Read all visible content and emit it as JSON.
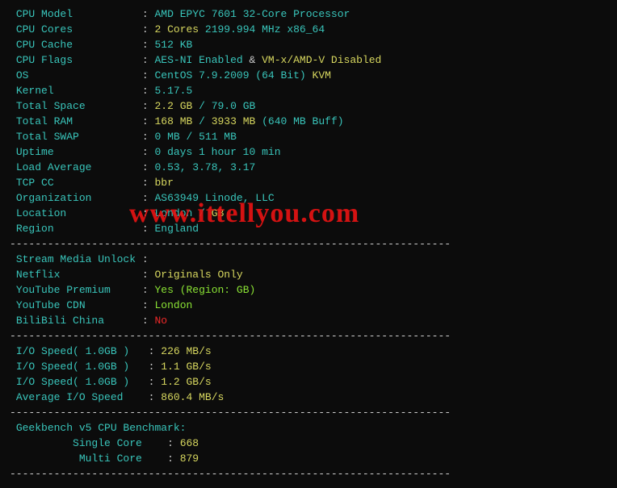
{
  "sys": {
    "cpu_model_label": "CPU Model",
    "cpu_model": "AMD EPYC 7601 32-Core Processor",
    "cpu_cores_label": "CPU Cores",
    "cpu_cores_count": "2 Cores",
    "cpu_cores_freq": "2199.994 MHz x86_64",
    "cpu_cache_label": "CPU Cache",
    "cpu_cache": "512 KB",
    "cpu_flags_label": "CPU Flags",
    "cpu_flags_a": "AES-NI Enabled",
    "amp": " & ",
    "cpu_flags_b": "VM-x/AMD-V Disabled",
    "os_label": "OS",
    "os_name": "CentOS 7.9.2009 (64 Bit)",
    "os_virt": "KVM",
    "kernel_label": "Kernel",
    "kernel": "5.17.5",
    "space_label": "Total Space",
    "space_used": "2.2 GB",
    "slash": " / ",
    "space_total": "79.0 GB",
    "ram_label": "Total RAM",
    "ram_used": "168 MB",
    "ram_total": "3933 MB",
    "ram_buff": "(640 MB Buff)",
    "swap_label": "Total SWAP",
    "swap_used": "0 MB",
    "swap_total": "511 MB",
    "uptime_label": "Uptime",
    "uptime": "0 days 1 hour 10 min",
    "load_label": "Load Average",
    "load": "0.53, 3.78, 3.17",
    "tcp_label": "TCP CC",
    "tcp": "bbr",
    "org_label": "Organization",
    "org": "AS63949 Linode, LLC",
    "loc_label": "Location",
    "loc_city": "London",
    "loc_cc": "GB",
    "region_label": "Region",
    "region": "England"
  },
  "stream": {
    "header": "Stream Media Unlock",
    "netflix_label": "Netflix",
    "netflix": "Originals Only",
    "ytp_label": "YouTube Premium",
    "ytp": "Yes (Region: GB)",
    "ytcdn_label": "YouTube CDN",
    "ytcdn": "London",
    "bili_label": "BiliBili China",
    "bili": "No"
  },
  "io": {
    "l1": "I/O Speed( 1.0GB )",
    "v1": "226 MB/s",
    "l2": "I/O Speed( 1.0GB )",
    "v2": "1.1 GB/s",
    "l3": "I/O Speed( 1.0GB )",
    "v3": "1.2 GB/s",
    "avg_label": "Average I/O Speed",
    "avg": "860.4 MB/s"
  },
  "gb": {
    "header": "Geekbench v5 CPU Benchmark:",
    "single_label": "Single Core",
    "single": "668",
    "multi_label": "Multi Core",
    "multi": "879"
  },
  "dash": "----------------------------------------------------------------------",
  "watermark": "www.ittellyou.com"
}
